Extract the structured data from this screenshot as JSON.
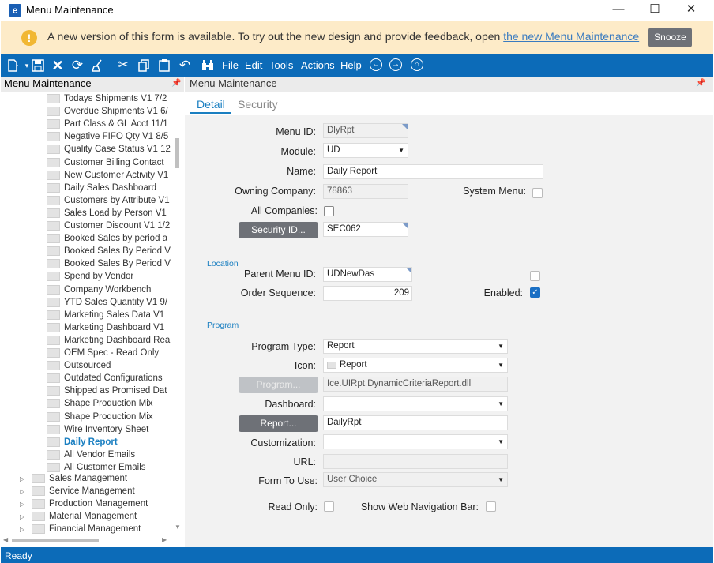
{
  "window": {
    "title": "Menu Maintenance",
    "logo_letter": "e",
    "minimize": "—",
    "maximize": "☐",
    "close": "✕"
  },
  "banner": {
    "text": "A new version of this form is available. To try out the new design and provide feedback, open ",
    "link": "the new Menu Maintenance",
    "snooze": "Snooze",
    "warn_glyph": "!"
  },
  "toolbar": {
    "menus": [
      "File",
      "Edit",
      "Tools",
      "Actions",
      "Help"
    ]
  },
  "left": {
    "title": "Menu Maintenance",
    "items": [
      "Todays Shipments V1 7/2",
      "Overdue Shipments V1 6/",
      "Part Class & GL Acct 11/1",
      "Negative FIFO Qty V1 8/5",
      "Quality Case Status V1 12",
      "Customer Billing Contact",
      "New Customer Activity V1",
      "Daily Sales Dashboard",
      "Customers by Attribute V1",
      "Sales Load by Person V1",
      "Customer Discount V1 1/2",
      "Booked Sales by period a",
      "Booked Sales By Period V",
      "Booked Sales By Period V",
      "Spend by Vendor",
      "Company Workbench",
      "YTD Sales Quantity V1 9/",
      "Marketing Sales Data V1",
      "Marketing Dashboard V1",
      "Marketing Dashboard Rea",
      "OEM Spec - Read Only",
      "Outsourced",
      "Outdated Configurations",
      "Shipped as Promised Dat",
      "Shape Production Mix",
      "Shape Production Mix",
      "Wire Inventory Sheet",
      "Daily Report",
      "All Vendor Emails",
      "All Customer Emails"
    ],
    "selected_index": 27,
    "groups": [
      "Sales Management",
      "Service Management",
      "Production Management",
      "Material Management",
      "Financial Management"
    ]
  },
  "right": {
    "title": "Menu Maintenance",
    "tabs": [
      "Detail",
      "Security"
    ],
    "labels": {
      "menu_id": "Menu ID:",
      "module": "Module:",
      "name": "Name:",
      "owning_company": "Owning Company:",
      "system_menu": "System Menu:",
      "all_companies": "All Companies:",
      "parent_menu_id": "Parent Menu ID:",
      "order_sequence": "Order Sequence:",
      "enabled": "Enabled:",
      "program_type": "Program Type:",
      "icon": "Icon:",
      "dashboard": "Dashboard:",
      "customization": "Customization:",
      "url": "URL:",
      "form_to_use": "Form To Use:",
      "read_only": "Read Only:",
      "show_web_nav": "Show Web Navigation Bar:"
    },
    "values": {
      "menu_id": "DlyRpt",
      "module": "UD",
      "name": "Daily Report",
      "owning_company": "78863",
      "security_id": "SEC062",
      "parent_menu_id": "UDNewDas",
      "order_sequence": "209",
      "program_type": "Report",
      "icon": "Report",
      "program": "Ice.UIRpt.DynamicCriteriaReport.dll",
      "dashboard": "",
      "report": "DailyRpt",
      "customization": "",
      "url": "",
      "form_to_use": "User Choice"
    },
    "buttons": {
      "security_id": "Security ID...",
      "program": "Program...",
      "report": "Report..."
    },
    "sections": {
      "location": "Location",
      "program": "Program"
    },
    "checks": {
      "system_menu": false,
      "all_companies": false,
      "parent_flag": false,
      "enabled": true,
      "read_only": false,
      "show_web_nav": false
    }
  },
  "status": {
    "text": "Ready"
  },
  "colors": {
    "accent": "#0c6bb8",
    "banner": "#fdebc8",
    "selected": "#1a7fc1"
  }
}
